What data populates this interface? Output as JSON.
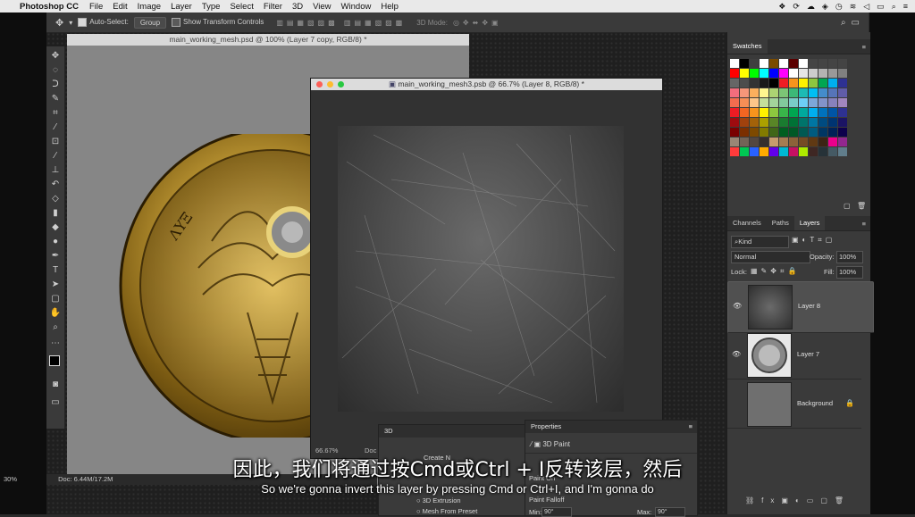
{
  "menubar": {
    "app_name": "Photoshop CC",
    "items": [
      "File",
      "Edit",
      "Image",
      "Layer",
      "Type",
      "Select",
      "Filter",
      "3D",
      "View",
      "Window",
      "Help"
    ]
  },
  "options_bar": {
    "auto_select_label": "Auto-Select:",
    "auto_select_value": "Group",
    "show_transform_label": "Show Transform Controls",
    "mode_label": "3D Mode:"
  },
  "doc1": {
    "title": "main_working_mesh.psd @ 100% (Layer 7 copy, RGB/8) *",
    "zoom": "30%",
    "doc_info": "Doc: 6.44M/17.2M"
  },
  "doc2": {
    "title": "main_working_mesh3.psb @ 66.7% (Layer 8, RGB/8) *",
    "zoom": "66.67%",
    "doc_label": "Doc"
  },
  "swatches_panel": {
    "tab": "Swatches",
    "colors": [
      "#ffffff",
      "#000000",
      "#3f3f3f",
      "#ffffff",
      "#7a4b00",
      "#ffffff",
      "#5a0000",
      "#ffffff",
      "#444444",
      "#444444",
      "#444444",
      "#444444",
      "#ff0000",
      "#ffff00",
      "#00ff00",
      "#00ffff",
      "#0000ff",
      "#ff00ff",
      "#ffffff",
      "#e6e6e6",
      "#cccccc",
      "#b3b3b3",
      "#999999",
      "#808080",
      "#666666",
      "#4d4d4d",
      "#333333",
      "#1a1a1a",
      "#000000",
      "#ee1d24",
      "#f7941d",
      "#fff200",
      "#8dc63f",
      "#00a651",
      "#00aeef",
      "#2e3192",
      "#f26d7d",
      "#f69679",
      "#fbaf5d",
      "#fff68f",
      "#acd373",
      "#7cc576",
      "#3cb878",
      "#1cbbb4",
      "#00bff3",
      "#448ccb",
      "#5674b9",
      "#605ca8",
      "#f26c4f",
      "#f68e56",
      "#fdc689",
      "#c4df9b",
      "#a3d39c",
      "#82ca9c",
      "#7accc8",
      "#6dcff6",
      "#7da7d9",
      "#8393ca",
      "#8781bd",
      "#a186be",
      "#ed1c24",
      "#f26522",
      "#f7941d",
      "#fff200",
      "#8dc73f",
      "#39b54a",
      "#00a651",
      "#00a99d",
      "#00aeef",
      "#0072bc",
      "#0054a6",
      "#2e3192",
      "#9e0b0f",
      "#a0410d",
      "#a36209",
      "#aba000",
      "#598527",
      "#1a7b30",
      "#007236",
      "#00746b",
      "#0076a3",
      "#004b80",
      "#003471",
      "#1b1464",
      "#790000",
      "#7b2e00",
      "#7d4900",
      "#827b00",
      "#406618",
      "#005e20",
      "#005826",
      "#005952",
      "#005b7f",
      "#003663",
      "#002157",
      "#0d004c",
      "#998675",
      "#736357",
      "#534741",
      "#362f2d",
      "#c69c6d",
      "#a67c52",
      "#8c6239",
      "#754c24",
      "#603913",
      "#3c2415",
      "#ec008c",
      "#92278f",
      "#ff3b3b",
      "#00c853",
      "#2962ff",
      "#ffab00",
      "#6200ea",
      "#00b8d4",
      "#c51162",
      "#aeea00",
      "#3e2723",
      "#263238",
      "#455a64",
      "#607d8b"
    ]
  },
  "layers_panel": {
    "tabs": [
      "Channels",
      "Paths",
      "Layers"
    ],
    "kind_label": "Kind",
    "blend_mode": "Normal",
    "opacity_label": "Opacity:",
    "opacity_value": "100%",
    "lock_label": "Lock:",
    "fill_label": "Fill:",
    "fill_value": "100%",
    "layers": [
      {
        "name": "Layer 8"
      },
      {
        "name": "Layer 7"
      },
      {
        "name": "Background"
      }
    ]
  },
  "panel_3d": {
    "tab": "3D",
    "items": [
      "Create N",
      "3D Extrusion",
      "Mesh From Preset"
    ]
  },
  "properties_panel": {
    "tab": "Properties",
    "mode": "3D Paint",
    "paint_on": "Paint On",
    "paint_falloff": "Paint Falloff",
    "min_label": "Min:",
    "min_value": "90°",
    "max_label": "Max:",
    "max_value": "90°"
  },
  "subtitles": {
    "chinese": "因此，我们将通过按Cmd或Ctrl + I反转该层，然后",
    "english": "So we're gonna invert this layer by pressing Cmd or Ctrl+I, and I'm gonna do"
  }
}
